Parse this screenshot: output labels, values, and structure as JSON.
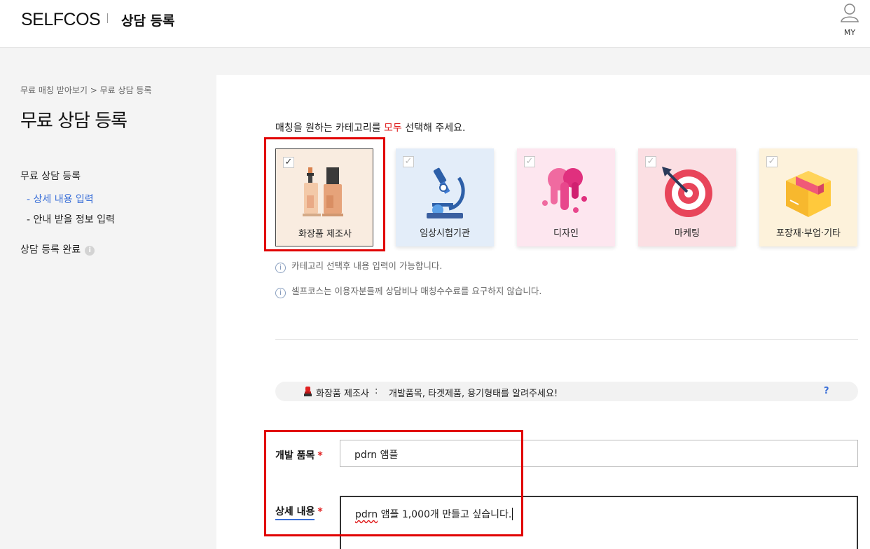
{
  "header": {
    "logo": "SELFCOS",
    "title": "상담 등록",
    "my_label": "MY"
  },
  "sidebar": {
    "breadcrumb": "무료 매칭 받아보기 > 무료 상담 등록",
    "page_title": "무료 상담 등록",
    "section_register": "무료 상담 등록",
    "step_detail": "- 상세 내용 입력",
    "step_info": "- 안내 받을 정보 입력",
    "complete": "상담 등록 완료",
    "info_glyph": "i"
  },
  "main": {
    "instruction_prefix": "매칭을 원하는 카테고리를 ",
    "instruction_emphasis": "모두",
    "instruction_suffix": " 선택해 주세요.",
    "categories": [
      {
        "label": "화장품 제조사",
        "selected": true,
        "bg": "#f9ece0",
        "icon": "cosmetic-bottles-icon"
      },
      {
        "label": "임상시험기관",
        "selected": false,
        "bg": "#e3edf9",
        "icon": "microscope-icon"
      },
      {
        "label": "디자인",
        "selected": false,
        "bg": "#fde6ef",
        "icon": "paint-drip-icon"
      },
      {
        "label": "마케팅",
        "selected": false,
        "bg": "#fbdfe3",
        "icon": "target-icon"
      },
      {
        "label": "포장재·부업·기타",
        "selected": false,
        "bg": "#fdf2db",
        "icon": "package-box-icon"
      }
    ],
    "checkmark": "✓",
    "notice_glyph": "i",
    "notices": [
      "카테고리 선택후 내용 입력이 가능합니다.",
      "셀프코스는 이용자분들께 상담비나 매칭수수료를 요구하지 않습니다."
    ],
    "hint": {
      "category": "화장품 제조사",
      "colon": ":",
      "text": "개발품목, 타겟제품, 용기형태를 알려주세요!",
      "help": "?"
    },
    "fields": {
      "dev_item_label": "개발 품목",
      "dev_item_value": "pdrn 앰플",
      "detail_label": "상세 내용",
      "detail_value_word": "pdrn",
      "detail_value_rest": " 앰플 1,000개 만들고 싶습니다.",
      "required_mark": "*"
    },
    "colors": {
      "accent": "#3a6fd8",
      "required": "#e02020",
      "highlight": "#e10000"
    }
  }
}
